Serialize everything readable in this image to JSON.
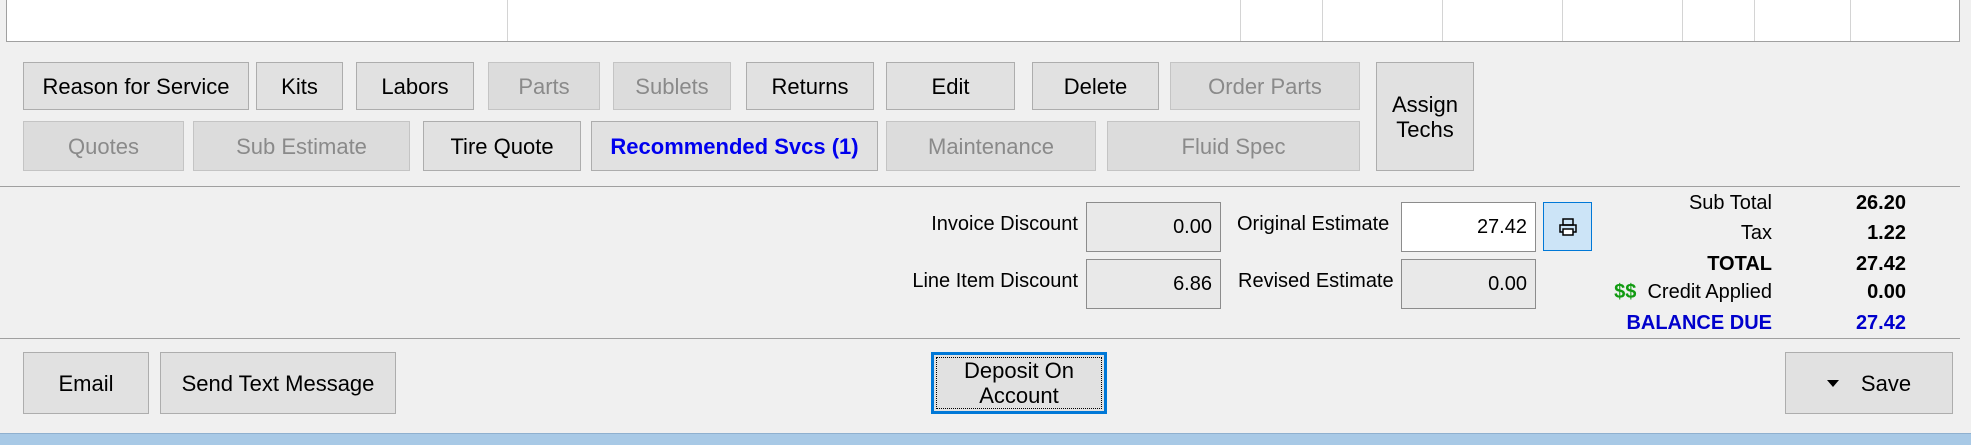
{
  "toolbar": {
    "row1": [
      {
        "label": "Reason for Service",
        "enabled": true
      },
      {
        "label": "Kits",
        "enabled": true
      },
      {
        "label": "Labors",
        "enabled": true
      },
      {
        "label": "Parts",
        "enabled": false
      },
      {
        "label": "Sublets",
        "enabled": false
      },
      {
        "label": "Returns",
        "enabled": true
      },
      {
        "label": "Edit",
        "enabled": true
      },
      {
        "label": "Delete",
        "enabled": true
      },
      {
        "label": "Order Parts",
        "enabled": false
      }
    ],
    "row2": [
      {
        "label": "Quotes",
        "enabled": false
      },
      {
        "label": "Sub Estimate",
        "enabled": false
      },
      {
        "label": "Tire Quote",
        "enabled": true
      },
      {
        "label": "Recommended Svcs (1)",
        "enabled": true
      },
      {
        "label": "Maintenance",
        "enabled": false
      },
      {
        "label": "Fluid Spec",
        "enabled": false
      }
    ],
    "assign_techs": "Assign\nTechs"
  },
  "discounts": {
    "invoice_discount_label": "Invoice Discount",
    "invoice_discount_value": "0.00",
    "line_item_discount_label": "Line Item Discount",
    "line_item_discount_value": "6.86"
  },
  "estimates": {
    "original_label": "Original Estimate",
    "original_value": "27.42",
    "revised_label": "Revised Estimate",
    "revised_value": "0.00",
    "print_icon": "print-icon"
  },
  "totals": {
    "sub_total_label": "Sub Total",
    "sub_total": "26.20",
    "tax_label": "Tax",
    "tax": "1.22",
    "total_label": "TOTAL",
    "total": "27.42",
    "credit_symbol": "$$",
    "credit_label": "Credit Applied",
    "credit": "0.00",
    "balance_label": "BALANCE DUE",
    "balance": "27.42"
  },
  "bottom": {
    "email": "Email",
    "send_text": "Send Text Message",
    "deposit": "Deposit On\nAccount",
    "save": "Save"
  },
  "colors": {
    "accent": "#0078d7",
    "balance_blue": "#0000cc",
    "credit_green": "#119b11"
  }
}
